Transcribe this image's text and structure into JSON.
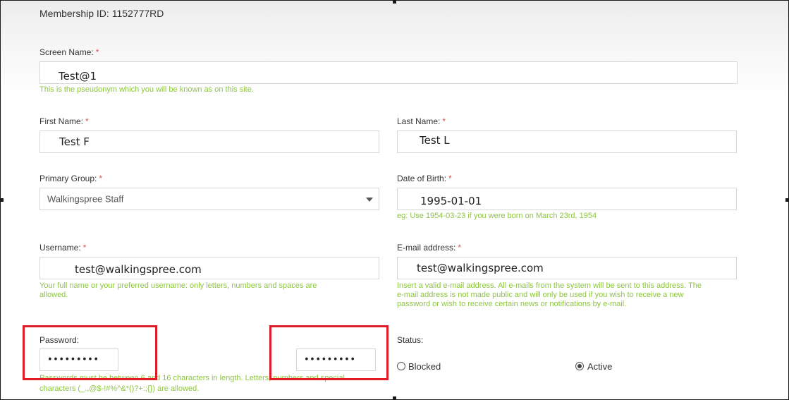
{
  "membership": {
    "text": "Membership ID: 1152777RD"
  },
  "required_mark": "*",
  "screen_name": {
    "label": "Screen Name:",
    "value": "Test@1",
    "hint": "This is the pseudonym which you will be known as on this site."
  },
  "first_name": {
    "label": "First Name:",
    "value": "Test F"
  },
  "last_name": {
    "label": "Last Name:",
    "value": "Test L"
  },
  "primary_group": {
    "label": "Primary Group:",
    "selected": "Walkingspree Staff"
  },
  "dob": {
    "label": "Date of Birth:",
    "value": "1995-01-01",
    "hint": "eg: Use 1954-03-23 if you were born on March 23rd, 1954"
  },
  "username": {
    "label": "Username:",
    "value": "test@walkingspree.com",
    "hint_line1": "Your full name or your preferred username: only letters, numbers and spaces are",
    "hint_line2": "allowed."
  },
  "email": {
    "label": "E-mail address:",
    "value": "test@walkingspree.com",
    "hint_line1": "Insert a valid e-mail address. All e-mails from the system will be sent to this address. The",
    "hint_line2": "e-mail address is not made public and will only be used if you wish to receive a new",
    "hint_line3": "password or wish to receive certain news or notifications by e-mail."
  },
  "password": {
    "label": "Password:",
    "value": "•••••••••",
    "confirm_value": "•••••••••",
    "hint_line1": "Passwords must be between 6 and 16 characters in length. Letters, numbers and special",
    "hint_line2": "characters (_.,@$-!#%^&*()?+:;{}) are allowed."
  },
  "status": {
    "label": "Status:",
    "options": [
      {
        "label": "Blocked",
        "checked": false
      },
      {
        "label": "Active",
        "checked": true
      }
    ]
  },
  "colors": {
    "highlight": "#e11a27",
    "hint": "#8dc63f",
    "required": "#d9534f"
  }
}
